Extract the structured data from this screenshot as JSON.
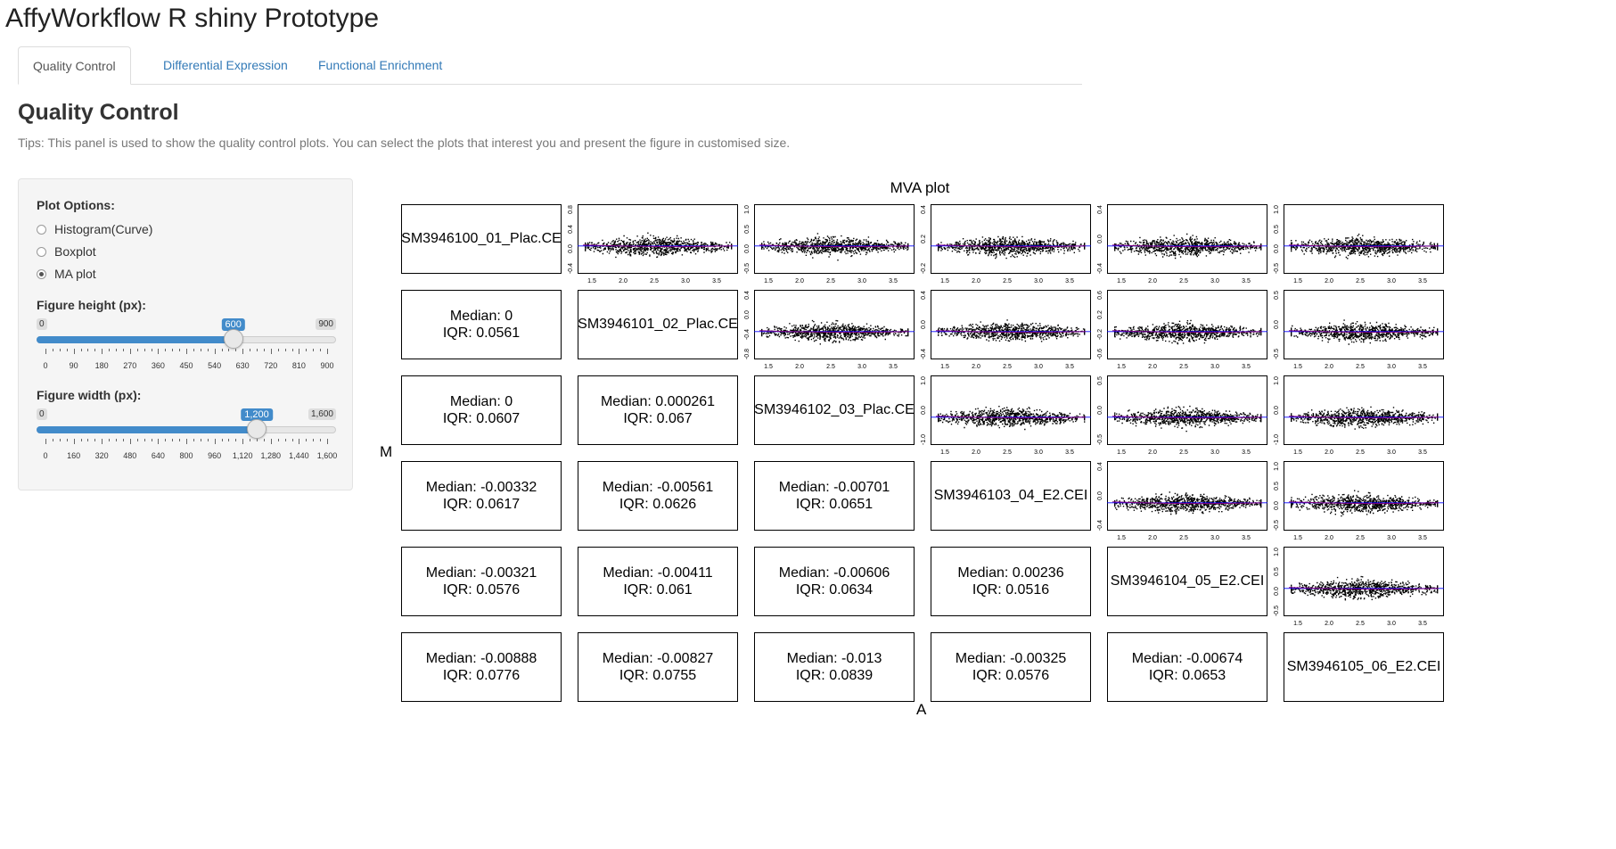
{
  "app": {
    "title": "AffyWorkflow R shiny Prototype"
  },
  "tabs": [
    {
      "label": "Quality Control",
      "active": true
    },
    {
      "label": "Differential Expression",
      "active": false
    },
    {
      "label": "Functional Enrichment",
      "active": false
    }
  ],
  "panel": {
    "title": "Quality Control",
    "tips": "Tips: This panel is used to show the quality control plots. You can select the plots that interest you and present the figure in customised size."
  },
  "sidebar": {
    "plot_options_label": "Plot Options:",
    "plot_options": [
      {
        "label": "Histogram(Curve)",
        "checked": false
      },
      {
        "label": "Boxplot",
        "checked": false
      },
      {
        "label": "MA plot",
        "checked": true
      }
    ],
    "height_slider": {
      "label": "Figure height (px):",
      "min": "0",
      "max": "900",
      "value": "600",
      "fraction": 0.6667,
      "ticks": [
        "0",
        "90",
        "180",
        "270",
        "360",
        "450",
        "540",
        "630",
        "720",
        "810",
        "900"
      ]
    },
    "width_slider": {
      "label": "Figure width (px):",
      "min": "0",
      "max": "1,600",
      "value": "1,200",
      "fraction": 0.75,
      "ticks": [
        "0",
        "160",
        "320",
        "480",
        "640",
        "800",
        "960",
        "1,120",
        "1,280",
        "1,440",
        "1,600"
      ]
    }
  },
  "plot": {
    "title": "MVA plot",
    "xlabel": "A",
    "ylabel": "M",
    "samples": [
      "SM3946100_01_Plac.CE",
      "SM3946101_02_Plac.CE",
      "SM3946102_03_Plac.CE",
      "SM3946103_04_E2.CEI",
      "SM3946104_05_E2.CEI",
      "SM3946105_06_E2.CEI"
    ],
    "stats": [
      [
        "",
        "",
        "",
        "",
        "",
        ""
      ],
      [
        {
          "median": "Median: 0",
          "iqr": "IQR: 0.0561"
        },
        "",
        "",
        "",
        "",
        ""
      ],
      [
        {
          "median": "Median: 0",
          "iqr": "IQR: 0.0607"
        },
        {
          "median": "Median: 0.000261",
          "iqr": "IQR: 0.067"
        },
        "",
        "",
        "",
        ""
      ],
      [
        {
          "median": "Median: -0.00332",
          "iqr": "IQR: 0.0617"
        },
        {
          "median": "Median: -0.00561",
          "iqr": "IQR: 0.0626"
        },
        {
          "median": "Median: -0.00701",
          "iqr": "IQR: 0.0651"
        },
        "",
        "",
        ""
      ],
      [
        {
          "median": "Median: -0.00321",
          "iqr": "IQR: 0.0576"
        },
        {
          "median": "Median: -0.00411",
          "iqr": "IQR: 0.061"
        },
        {
          "median": "Median: -0.00606",
          "iqr": "IQR: 0.0634"
        },
        {
          "median": "Median: 0.00236",
          "iqr": "IQR: 0.0516"
        },
        "",
        ""
      ],
      [
        {
          "median": "Median: -0.00888",
          "iqr": "IQR: 0.0776"
        },
        {
          "median": "Median: -0.00827",
          "iqr": "IQR: 0.0755"
        },
        {
          "median": "Median: -0.013",
          "iqr": "IQR: 0.0839"
        },
        {
          "median": "Median: -0.00325",
          "iqr": "IQR: 0.0576"
        },
        {
          "median": "Median: -0.00674",
          "iqr": "IQR: 0.0653"
        },
        ""
      ]
    ],
    "x_ticks": [
      "1.5",
      "2.0",
      "2.5",
      "3.0",
      "3.5"
    ],
    "y_ticks": {
      "0-1": [
        "-0.4",
        "0.0",
        "0.4",
        "0.8"
      ],
      "0-2": [
        "-0.5",
        "0.0",
        "0.5",
        "1.0"
      ],
      "0-3": [
        "-0.2",
        "0.2",
        "0.4"
      ],
      "0-4": [
        "-0.4",
        "0.0",
        "0.4"
      ],
      "0-5": [
        "-0.5",
        "0.0",
        "0.5",
        "1.0"
      ],
      "1-2": [
        "-0.8",
        "-0.4",
        "0.0",
        "0.4"
      ],
      "1-3": [
        "-0.4",
        "0.0",
        "0.4"
      ],
      "1-4": [
        "-0.6",
        "-0.2",
        "0.2",
        "0.6"
      ],
      "1-5": [
        "-0.5",
        "0.0",
        "0.5"
      ],
      "2-3": [
        "-1.0",
        "0.0",
        "1.0"
      ],
      "2-4": [
        "-0.5",
        "0.0",
        "0.5"
      ],
      "2-5": [
        "-1.0",
        "0.0",
        "1.0"
      ],
      "3-4": [
        "-0.4",
        "0.0",
        "0.4"
      ],
      "3-5": [
        "-0.5",
        "0.0",
        "0.5",
        "1.0"
      ],
      "4-5": [
        "-0.5",
        "0.0",
        "0.5",
        "1.0"
      ]
    },
    "point_color": "#000000",
    "loess_color": "#800080",
    "ref_line_color": "#0000ff"
  }
}
